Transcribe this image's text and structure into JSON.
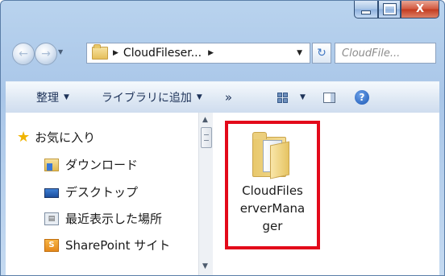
{
  "window": {
    "caption_buttons": {
      "minimize": "–",
      "maximize": "□",
      "close": "X"
    }
  },
  "address_bar": {
    "back_arrow": "←",
    "forward_arrow": "→",
    "nav_dropdown": "▼",
    "path_separator": "▶",
    "path_text": "CloudFileser...",
    "path_separator_after": "▶",
    "dropdown": "▼",
    "refresh": "↻"
  },
  "search": {
    "placeholder": "CloudFile..."
  },
  "toolbar": {
    "organize_label": "整理",
    "add_to_library_label": "ライブラリに追加",
    "more_label": "»",
    "dropdown_arrow": "▼",
    "help_label": "?"
  },
  "nav_pane": {
    "favorites_label": "お気に入り",
    "items": [
      {
        "label": "ダウンロード"
      },
      {
        "label": "デスクトップ"
      },
      {
        "label": "最近表示した場所"
      },
      {
        "label": "SharePoint サイト"
      }
    ],
    "scroll_up": "▲",
    "scroll_down": "▼"
  },
  "files": [
    {
      "line1": "CloudFiles",
      "line2": "erverMana",
      "line3": "ger"
    }
  ],
  "colors": {
    "highlight_border": "#e3091a",
    "toolbar_text": "#1e3359"
  }
}
